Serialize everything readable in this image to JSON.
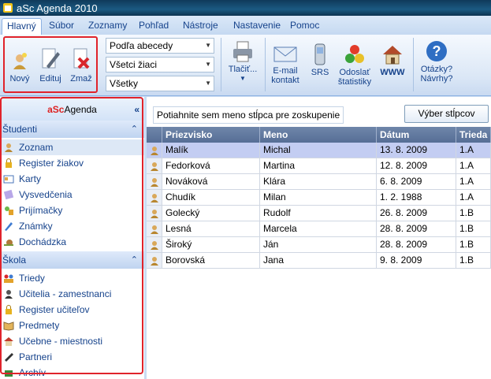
{
  "window": {
    "title": "aSc Agenda 2010"
  },
  "tabs": [
    "Hlavný",
    "Súbor",
    "Zoznamy",
    "Pohľad",
    "Nástroje",
    "Nastavenie",
    "Pomoc"
  ],
  "ribbon": {
    "new_label": "Nový",
    "edit_label": "Edituj",
    "delete_label": "Zmaž",
    "sort_combo": "Podľa abecedy",
    "filter_combo": "Všetci žiaci",
    "scope_combo": "Všetky",
    "print_label": "Tlačiť...",
    "email_label": "E-mail kontakt",
    "sms_label": "SRS",
    "stats_label": "Odoslať štatistiky",
    "www_label": "WWW",
    "help_label": "Otázky? Návrhy?"
  },
  "sidebar": {
    "header_a": "aSc",
    "header_rest": "Agenda",
    "section_students": "Študenti",
    "students_items": [
      "Zoznam",
      "Register žiakov",
      "Karty",
      "Vysvedčenia",
      "Prijímačky",
      "Známky",
      "Dochádzka"
    ],
    "section_school": "Škola",
    "school_items": [
      "Triedy",
      "Učitelia - zamestnanci",
      "Register učiteľov",
      "Predmety",
      "Učebne - miestnosti",
      "Partneri",
      "Archív"
    ]
  },
  "grid": {
    "group_hint": "Potiahnite sem meno stĺpca pre zoskupenie",
    "column_chooser": "Výber stĺpcov",
    "columns": [
      "Priezvisko",
      "Meno",
      "Dátum narodenia",
      "Trieda"
    ],
    "rows": [
      [
        "Malík",
        "Michal",
        "13. 8. 2009",
        "1.A"
      ],
      [
        "Fedorková",
        "Martina",
        "12. 8. 2009",
        "1.A"
      ],
      [
        "Nováková",
        "Klára",
        "6. 8. 2009",
        "1.A"
      ],
      [
        "Chudík",
        "Milan",
        "1. 2. 1988",
        "1.A"
      ],
      [
        "Golecký",
        "Rudolf",
        "26. 8. 2009",
        "1.B"
      ],
      [
        "Lesná",
        "Marcela",
        "28. 8. 2009",
        "1.B"
      ],
      [
        "Široký",
        "Ján",
        "28. 8. 2009",
        "1.B"
      ],
      [
        "Borovská",
        "Jana",
        "9. 8. 2009",
        "1.B"
      ]
    ]
  },
  "colors": {
    "highlight_border": "#e0232b",
    "title_bar": "#1b5a82",
    "selected_row": "#c3cdf2"
  }
}
